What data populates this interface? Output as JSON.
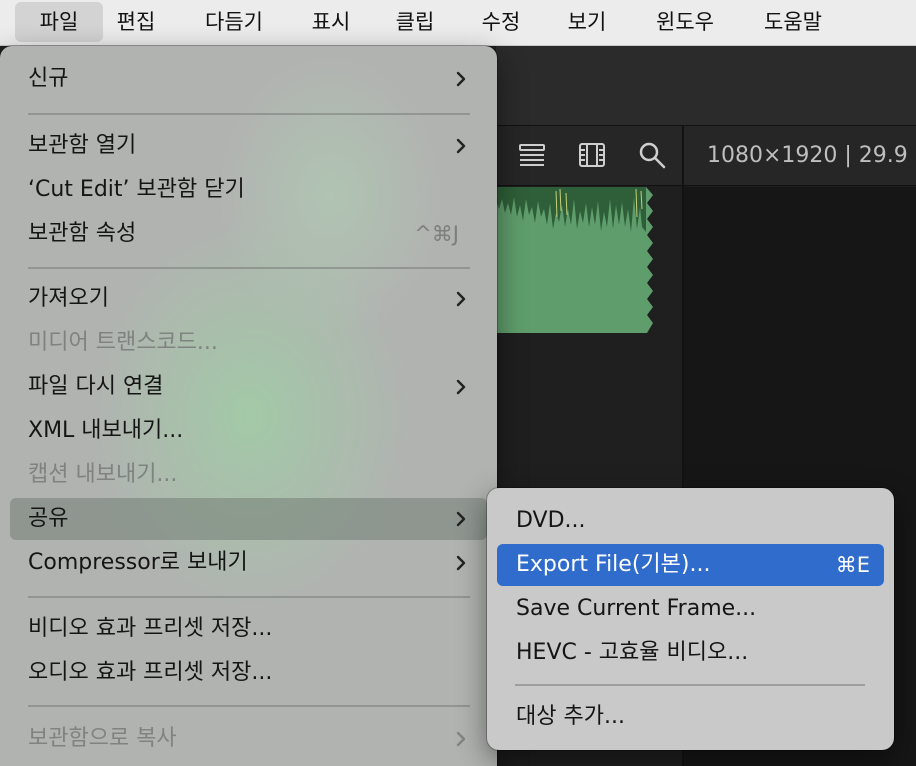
{
  "menubar": {
    "items": [
      "파일",
      "편집",
      "다듬기",
      "표시",
      "클립",
      "수정",
      "보기",
      "윈도우",
      "도움말"
    ],
    "active_index": 0
  },
  "app": {
    "format_readout": "1080×1920 | 29.9",
    "toolbar_icons": [
      "list-view-icon",
      "filmstrip-icon",
      "search-icon"
    ]
  },
  "file_menu": {
    "items": [
      {
        "label": "신규",
        "submenu": true,
        "enabled": true
      },
      {
        "label": "보관함 열기",
        "submenu": true,
        "enabled": true
      },
      {
        "label": "‘Cut Edit’ 보관함 닫기",
        "enabled": true
      },
      {
        "label": "보관함 속성",
        "shortcut": "^⌘J",
        "enabled": true
      },
      {
        "label": "가져오기",
        "submenu": true,
        "enabled": true
      },
      {
        "label": "미디어 트랜스코드...",
        "enabled": false
      },
      {
        "label": "파일 다시 연결",
        "submenu": true,
        "enabled": true
      },
      {
        "label": "XML 내보내기...",
        "enabled": true
      },
      {
        "label": "캡션 내보내기...",
        "enabled": false
      },
      {
        "label": "공유",
        "submenu": true,
        "enabled": true,
        "highlighted": true
      },
      {
        "label": "Compressor로 보내기",
        "submenu": true,
        "enabled": true
      },
      {
        "label": "비디오 효과 프리셋 저장...",
        "enabled": true
      },
      {
        "label": "오디오 효과 프리셋 저장...",
        "enabled": true
      },
      {
        "label": "보관함으로 복사",
        "submenu": true,
        "enabled": false
      }
    ]
  },
  "share_submenu": {
    "items": [
      {
        "label": "DVD..."
      },
      {
        "label": "Export File(기본)...",
        "shortcut": "⌘E",
        "selected": true
      },
      {
        "label": "Save Current Frame..."
      },
      {
        "label": "HEVC - 고효율 비디오..."
      },
      {
        "label": "대상 추가..."
      }
    ]
  },
  "colors": {
    "selection_blue": "#2f6ccc",
    "menu_gray": "#b1b3b1",
    "waveform_green": "#5f9e6c"
  }
}
